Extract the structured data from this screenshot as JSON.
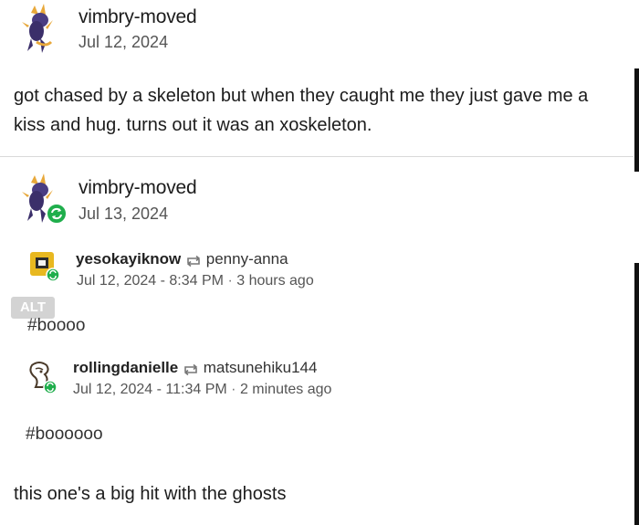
{
  "post": {
    "author": "vimbry-moved",
    "date": "Jul 12, 2024",
    "text": "got chased by a skeleton but when they caught me they just gave me a kiss and hug. turns out it was an xoskeleton."
  },
  "reblog": {
    "author": "vimbry-moved",
    "date": "Jul 13, 2024",
    "notes": [
      {
        "user": "yesokayiknow",
        "via": "penny-anna",
        "timestamp": "Jul 12, 2024 - 8:34 PM",
        "ago": "3 hours ago",
        "tag": "#boooo"
      },
      {
        "user": "rollingdanielle",
        "via": "matsunehiku144",
        "timestamp": "Jul 12, 2024 - 11:34 PM",
        "ago": "2 minutes ago",
        "tag": "#boooooo"
      }
    ],
    "alt_badge": "ALT",
    "final_text": "this one's a big hit with the ghosts"
  },
  "icons": {
    "avatar": "spyro-avatar-icon",
    "reblog": "reblog-icon",
    "small_avatar_1": "yellow-avatar-icon",
    "small_avatar_2": "dragon-avatar-icon"
  },
  "colors": {
    "reblog_badge": "#1fae4c",
    "avatar_purple": "#3d2f6f"
  }
}
